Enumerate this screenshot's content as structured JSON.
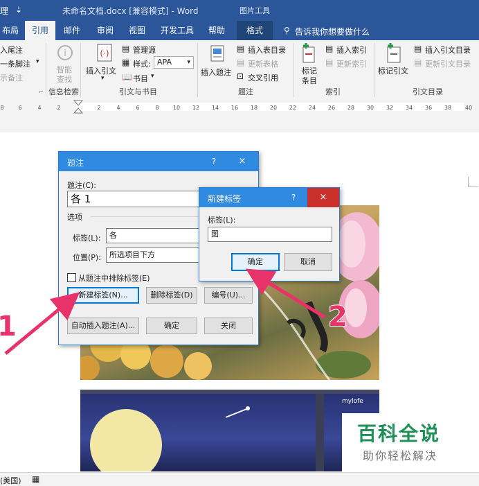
{
  "window": {
    "left_partial": "理",
    "qat_icon": "⇣",
    "doc_title": "未命名文档.docx [兼容模式] - Word",
    "picture_tools": "图片工具"
  },
  "tabs": [
    {
      "label": "布局"
    },
    {
      "label": "引用",
      "active": true
    },
    {
      "label": "邮件"
    },
    {
      "label": "审阅"
    },
    {
      "label": "视图"
    },
    {
      "label": "开发工具"
    },
    {
      "label": "帮助"
    },
    {
      "label": "格式"
    }
  ],
  "tellme": "告诉我你想要做什么",
  "ribbon": {
    "footnotes": {
      "insert_endnote": "入尾注",
      "next_footnote": "一条脚注",
      "show_notes": "示备注"
    },
    "info": {
      "smart_lookup": "智能查找",
      "smart_lookup_l1": "智能",
      "smart_lookup_l2": "查找",
      "group": "信息检索"
    },
    "citations": {
      "insert_citation": "插入引文",
      "manage_sources": "管理源",
      "style_label": "样式:",
      "style_value": "APA",
      "bibliography": "书目",
      "group": "引文与书目"
    },
    "captions": {
      "insert_caption": "插入题注",
      "insert_table_of_figures": "插入表目录",
      "update_table": "更新表格",
      "cross_reference": "交叉引用",
      "group": "题注"
    },
    "index": {
      "mark_entry_l1": "标记",
      "mark_entry_l2": "条目",
      "insert_index": "插入索引",
      "update_index": "更新索引",
      "group": "索引"
    },
    "toa": {
      "mark_citation": "标记引文",
      "insert_toa": "插入引文目录",
      "update_toa": "更新引文目录",
      "group": "引文目录"
    }
  },
  "ruler": [
    "8",
    "6",
    "4",
    "2",
    "2",
    "4",
    "6",
    "8",
    "10",
    "12",
    "14",
    "16",
    "18",
    "20",
    "22",
    "24",
    "26",
    "28",
    "30",
    "32",
    "34",
    "36",
    "38",
    "40"
  ],
  "caption_dialog": {
    "title": "题注",
    "help": "?",
    "close": "×",
    "caption_label": "题注(C):",
    "caption_value": "各 1",
    "options_label": "选项",
    "label_label": "标签(L):",
    "label_value": "各",
    "position_label": "位置(P):",
    "position_value": "所选项目下方",
    "exclude_label": "从题注中排除标签(E)",
    "new_label_btn": "新建标签(N)...",
    "delete_label_btn": "删除标签(D)",
    "numbering_btn": "编号(U)...",
    "autocaption_btn": "自动插入题注(A)...",
    "ok_btn": "确定",
    "close_btn": "关闭"
  },
  "new_label_dialog": {
    "title": "新建标签",
    "help": "?",
    "close": "×",
    "label_label": "标签(L):",
    "label_value": "图",
    "ok_btn": "确定",
    "cancel_btn": "取消"
  },
  "annotations": {
    "step1": "1",
    "step2": "2"
  },
  "image_watermark": "mylofe",
  "watermark": {
    "line1": "百科全说",
    "line2": "助你轻松解决"
  },
  "status": {
    "language": "(美国)"
  },
  "colors": {
    "word_blue": "#2b579a",
    "dialog_caption": "#2f8ae0",
    "close_red": "#c9302c",
    "arrow_pink": "#e8336a",
    "watermark_green": "#1d8f57"
  }
}
